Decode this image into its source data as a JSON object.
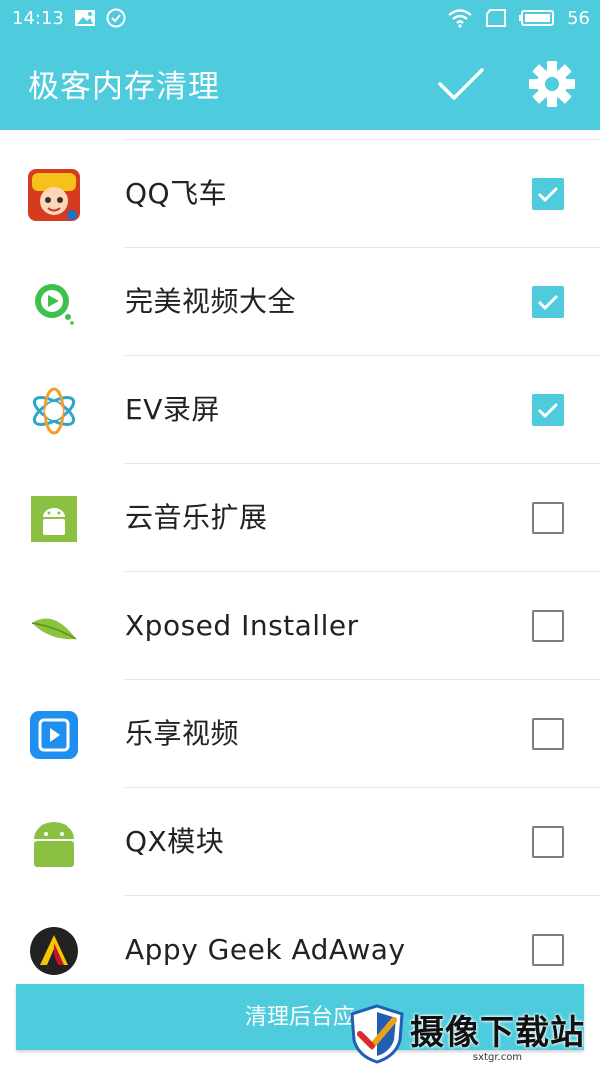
{
  "status_bar": {
    "time": "14:13",
    "battery_level": "56",
    "icons": [
      "image-icon",
      "check-circle-icon",
      "wifi-icon",
      "sim-icon",
      "battery-icon"
    ]
  },
  "app_bar": {
    "title": "极客内存清理",
    "icons": [
      "checkmark-icon",
      "gear-icon"
    ]
  },
  "apps": [
    {
      "name": "QQ飞车",
      "checked": true,
      "icon": "qq-speed-icon"
    },
    {
      "name": "完美视频大全",
      "checked": true,
      "icon": "video-player-icon"
    },
    {
      "name": "EV录屏",
      "checked": true,
      "icon": "ev-recorder-icon"
    },
    {
      "name": "云音乐扩展",
      "checked": false,
      "icon": "android-icon"
    },
    {
      "name": "Xposed Installer",
      "checked": false,
      "icon": "leaf-icon"
    },
    {
      "name": "乐享视频",
      "checked": false,
      "icon": "play-box-icon"
    },
    {
      "name": "QX模块",
      "checked": false,
      "icon": "android-icon"
    },
    {
      "name": "Appy Geek AdAway",
      "checked": false,
      "icon": "appy-geek-icon"
    }
  ],
  "bottom_button": {
    "label": "清理后台应"
  },
  "watermark": {
    "title": "摄像下载站",
    "url": "sxtgr.com"
  },
  "colors": {
    "primary": "#4ecbdc",
    "text": "#222222",
    "divider": "#e3e3e3",
    "checkbox_border": "#7d7d7d"
  }
}
